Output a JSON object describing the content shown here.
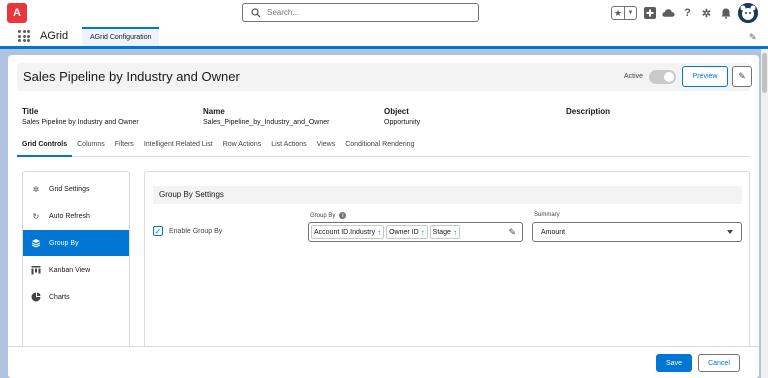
{
  "header": {
    "logo_text": "A",
    "search_placeholder": "Search..."
  },
  "nav": {
    "app_name": "AGrid",
    "tab_label": "AGrid Configuration"
  },
  "page": {
    "title": "Sales Pipeline by Industry and Owner",
    "active_label": "Active",
    "active_on": false,
    "preview_label": "Preview"
  },
  "meta": {
    "title_label": "Title",
    "title_value": "Sales Pipeline by Industry and Owner",
    "name_label": "Name",
    "name_value": "Sales_Pipeline_by_Industry_and_Owner",
    "object_label": "Object",
    "object_value": "Opportunity",
    "description_label": "Description",
    "description_value": ""
  },
  "tabs": [
    {
      "label": "Grid Controls",
      "active": true
    },
    {
      "label": "Columns"
    },
    {
      "label": "Filters"
    },
    {
      "label": "Intelligent Related List"
    },
    {
      "label": "Row Actions"
    },
    {
      "label": "List Actions"
    },
    {
      "label": "Views"
    },
    {
      "label": "Conditional Rendering"
    }
  ],
  "sidebar": {
    "items": [
      {
        "label": "Grid Settings",
        "icon": "gear-icon"
      },
      {
        "label": "Auto Refresh",
        "icon": "refresh-icon"
      },
      {
        "label": "Group By",
        "icon": "layers-icon",
        "selected": true
      },
      {
        "label": "Kanban View",
        "icon": "kanban-icon"
      },
      {
        "label": "Charts",
        "icon": "pie-chart-icon"
      }
    ]
  },
  "groupby": {
    "section_title": "Group By Settings",
    "enable_label": "Enable Group By",
    "enabled": true,
    "field_label": "Group By",
    "pills": [
      {
        "label": "Account ID.Industry"
      },
      {
        "label": "Owner ID"
      },
      {
        "label": "Stage"
      }
    ],
    "summary_label": "Summary",
    "summary_value": "Amount"
  },
  "footer": {
    "save_label": "Save",
    "cancel_label": "Cancel"
  },
  "colors": {
    "brand": "#0176d3",
    "logo": "#e8363a",
    "page_bg": "#b0c4df"
  }
}
